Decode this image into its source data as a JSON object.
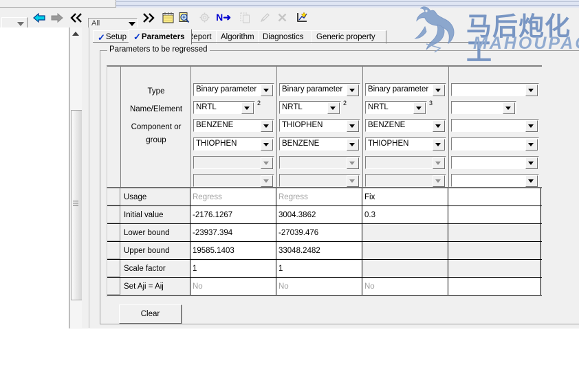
{
  "toolbar": {
    "filter_value": "All",
    "icons": [
      {
        "name": "back-arrow-icon",
        "glyph": "←"
      },
      {
        "name": "forward-arrow-icon",
        "glyph": "→"
      },
      {
        "name": "collapse-all-icon",
        "glyph": "«"
      },
      {
        "name": "expand-all-icon",
        "glyph": "»"
      },
      {
        "name": "notepad-icon",
        "glyph": ""
      },
      {
        "name": "input-summary-icon",
        "glyph": ""
      },
      {
        "name": "settings-icon",
        "glyph": ""
      },
      {
        "name": "next-input-icon",
        "glyph": "N➜"
      },
      {
        "name": "copy-icon",
        "glyph": ""
      },
      {
        "name": "edit-pencil-icon",
        "glyph": ""
      },
      {
        "name": "delete-icon",
        "glyph": "✕"
      },
      {
        "name": "plot-wizard-icon",
        "glyph": ""
      }
    ]
  },
  "tabs": [
    {
      "label": "Setup",
      "check": "✓",
      "active": false
    },
    {
      "label": "Parameters",
      "check": "✓",
      "active": true
    },
    {
      "label": "Report",
      "check": "",
      "active": false
    },
    {
      "label": "Algorithm",
      "check": "",
      "active": false
    },
    {
      "label": "Diagnostics",
      "check": "",
      "active": false
    },
    {
      "label": "Generic property",
      "check": "",
      "active": false
    }
  ],
  "group": {
    "title": "Parameters to be regressed"
  },
  "param_table": {
    "row_labels": [
      "Type",
      "Name/Element",
      "Component or",
      "group"
    ],
    "columns": [
      {
        "type": "Binary parameter",
        "name_element": "NRTL",
        "name_element_superscript": "2",
        "component1": "BENZENE",
        "component2": "THIOPHEN",
        "component3": "",
        "component4": "",
        "enabled": true
      },
      {
        "type": "Binary parameter",
        "name_element": "NRTL",
        "name_element_superscript": "2",
        "component1": "THIOPHEN",
        "component2": "BENZENE",
        "component3": "",
        "component4": "",
        "enabled": true
      },
      {
        "type": "Binary parameter",
        "name_element": "NRTL",
        "name_element_superscript": "3",
        "component1": "BENZENE",
        "component2": "THIOPHEN",
        "component3": "",
        "component4": "",
        "enabled": true
      },
      {
        "type": "",
        "name_element": "",
        "name_element_superscript": "",
        "component1": "",
        "component2": "",
        "component3": "",
        "component4": "",
        "enabled": true
      }
    ]
  },
  "value_table": {
    "rows": [
      {
        "label": "Usage",
        "values": [
          "Regress",
          "Regress",
          "Fix",
          ""
        ],
        "dim": [
          true,
          true,
          false,
          false
        ],
        "gray": [
          false,
          false,
          false,
          false
        ]
      },
      {
        "label": "Initial value",
        "values": [
          "-2176.1267",
          "3004.3862",
          "0.3",
          ""
        ],
        "dim": [
          false,
          false,
          false,
          false
        ],
        "gray": [
          false,
          false,
          false,
          false
        ]
      },
      {
        "label": "Lower bound",
        "values": [
          "-23937.394",
          "-27039.476",
          "",
          ""
        ],
        "dim": [
          false,
          false,
          false,
          false
        ],
        "gray": [
          false,
          false,
          true,
          true
        ]
      },
      {
        "label": "Upper bound",
        "values": [
          "19585.1403",
          "33048.2482",
          "",
          ""
        ],
        "dim": [
          false,
          false,
          false,
          false
        ],
        "gray": [
          false,
          false,
          true,
          true
        ]
      },
      {
        "label": "Scale factor",
        "values": [
          "1",
          "1",
          "",
          ""
        ],
        "dim": [
          false,
          false,
          false,
          false
        ],
        "gray": [
          false,
          false,
          true,
          true
        ]
      },
      {
        "label": "Set Aji = Aij",
        "values": [
          "No",
          "No",
          "No",
          ""
        ],
        "dim": [
          true,
          true,
          true,
          false
        ],
        "gray": [
          false,
          false,
          false,
          false
        ]
      }
    ]
  },
  "buttons": {
    "clear": "Clear"
  },
  "watermark": {
    "chinese": "马后炮化工",
    "english": "MAHOUPAO"
  },
  "colors": {
    "accent_blue": "#0033cc",
    "watermark_blue": "#6f8fc0",
    "window_face": "#f0f0f0"
  }
}
